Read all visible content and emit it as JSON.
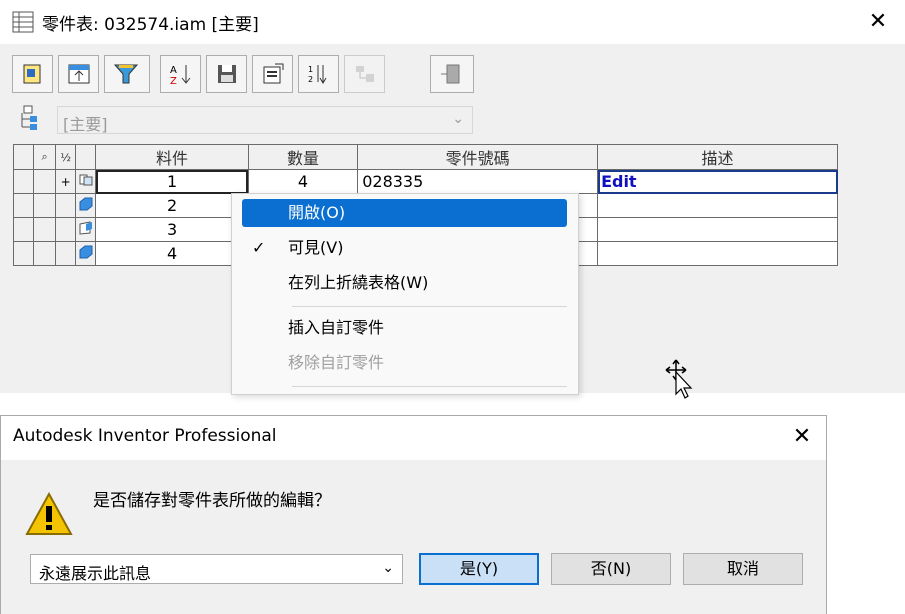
{
  "window": {
    "title": "零件表: 032574.iam [主要]",
    "close_glyph": "✕"
  },
  "toolbar": {
    "buttons": [
      "edit-bom-icon",
      "view-bom-icon",
      "filter-icon",
      "sort-icon",
      "export-icon",
      "report-icon",
      "renumber-icon",
      "merge-icon",
      "column-icon"
    ]
  },
  "bom_view": {
    "selected": "[主要]",
    "arrow": "⌄"
  },
  "grid": {
    "headers": {
      "item": "料件",
      "qty": "數量",
      "part_number": "零件號碼",
      "description": "描述"
    },
    "header_icons": [
      "⌕",
      "½"
    ],
    "rows": [
      {
        "expander": "+",
        "item": "1",
        "qty": "4",
        "part_number": "028335",
        "description": "Edit"
      },
      {
        "expander": "",
        "item": "2",
        "qty": "",
        "part_number": "",
        "description": ""
      },
      {
        "expander": "",
        "item": "3",
        "qty": "",
        "part_number": "",
        "description": ""
      },
      {
        "expander": "",
        "item": "4",
        "qty": "",
        "part_number": "",
        "description": ""
      }
    ]
  },
  "context_menu": {
    "items": [
      {
        "label": "開啟(O)",
        "highlighted": true
      },
      {
        "label": "可見(V)",
        "checked": true,
        "check_glyph": "✓"
      },
      {
        "label": "在列上折繞表格(W)"
      },
      {
        "label": "插入自訂零件"
      },
      {
        "label": "移除自訂零件",
        "disabled": true
      }
    ]
  },
  "dialog": {
    "title": "Autodesk Inventor Professional",
    "close_glyph": "✕",
    "message": "是否儲存對零件表所做的編輯？",
    "dropdown_value": "永遠展示此訊息",
    "dropdown_arrow": "⌄",
    "buttons": {
      "yes": "是(Y)",
      "no": "否(N)",
      "cancel": "取消"
    }
  },
  "colors": {
    "highlight": "#0a6fd0",
    "edit_text": "#1010c0",
    "warning": "#f5c400"
  }
}
